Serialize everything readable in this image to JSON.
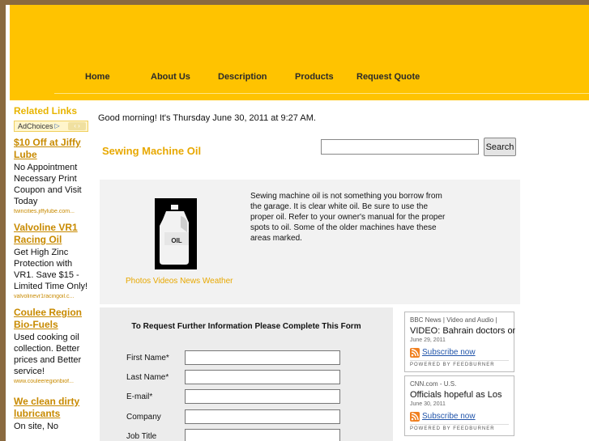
{
  "nav": {
    "items": [
      "Home",
      "About Us",
      "Description",
      "Products",
      "Request Quote"
    ]
  },
  "sidebar": {
    "heading": "Related Links",
    "adchoices_label": "AdChoices",
    "ads": [
      {
        "title": "$10 Off at Jiffy Lube",
        "body": "No Appointment Necessary Print Coupon and Visit Today",
        "url": "twincities.jiffylube.com..."
      },
      {
        "title": "Valvoline VR1 Racing Oil",
        "body": "Get High Zinc Protection with VR1. Save $15 - Limited Time Only!",
        "url": "valvolinevr1racingoil.c..."
      },
      {
        "title": "Coulee Region Bio-Fuels",
        "body": "Used cooking oil collection. Better prices and Better service!",
        "url": "www.couleeregionbiof..."
      },
      {
        "title": "We clean dirty lubricants",
        "body": "On site, No",
        "url": ""
      }
    ]
  },
  "greeting": "Good morning! It's Thursday June 30, 2011 at 9:27 AM.",
  "page_title": "Sewing Machine Oil",
  "search": {
    "button_label": "Search",
    "value": ""
  },
  "content": {
    "image_label": "OIL",
    "caption": "Photos Videos News Weather",
    "description": "Sewing machine oil is not something you borrow from the garage. It is clear white oil. Be sure to use the proper oil. Refer to your owner's manual for the proper spots to oil. Some of the older machines have these areas marked."
  },
  "form": {
    "heading": "To Request Further Information Please Complete This Form",
    "fields": [
      "First Name*",
      "Last Name*",
      "E-mail*",
      "Company",
      "Job Title"
    ]
  },
  "feeds": [
    {
      "source": "BBC News | Video and Audio |",
      "headline": "VIDEO: Bahrain doctors on",
      "date": "June 29, 2011",
      "subscribe": "Subscribe now",
      "powered": "POWERED BY FEEDBURNER"
    },
    {
      "source": "CNN.com - U.S.",
      "headline": "Officials hopeful as Los",
      "date": "June 30, 2011",
      "subscribe": "Subscribe now",
      "powered": "POWERED BY FEEDBURNER"
    }
  ],
  "colors": {
    "header": "#ffc300",
    "accent": "#e8a800",
    "background": "#8a6a3f"
  }
}
